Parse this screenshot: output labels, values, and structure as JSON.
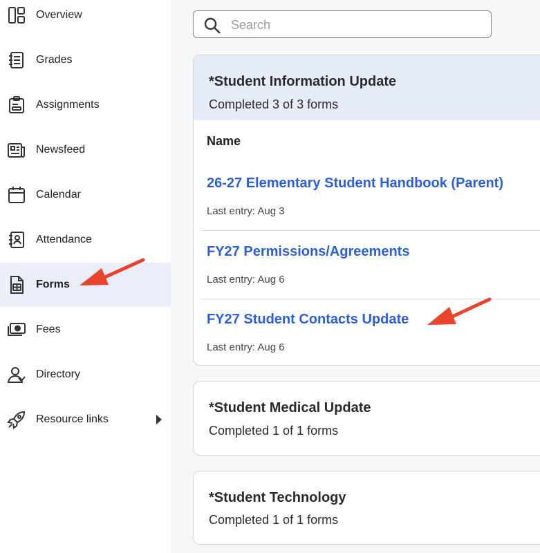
{
  "sidebar": {
    "items": [
      {
        "label": "Overview",
        "icon": "overview-icon"
      },
      {
        "label": "Grades",
        "icon": "gradebook-icon"
      },
      {
        "label": "Assignments",
        "icon": "clipboard-icon"
      },
      {
        "label": "Newsfeed",
        "icon": "newspaper-icon"
      },
      {
        "label": "Calendar",
        "icon": "calendar-icon"
      },
      {
        "label": "Attendance",
        "icon": "contact-book-icon"
      },
      {
        "label": "Forms",
        "icon": "form-document-icon",
        "active": true
      },
      {
        "label": "Fees",
        "icon": "cash-icon"
      },
      {
        "label": "Directory",
        "icon": "people-icon"
      },
      {
        "label": "Resource links",
        "icon": "rocket-icon"
      }
    ]
  },
  "search": {
    "placeholder": "Search"
  },
  "cards": [
    {
      "title": "*Student Information Update",
      "subtitle": "Completed 3 of 3 forms",
      "column_header": "Name",
      "forms": [
        {
          "name": "26-27 Elementary Student Handbook (Parent)",
          "meta": "Last entry: Aug 3"
        },
        {
          "name": "FY27 Permissions/Agreements",
          "meta": "Last entry: Aug 6"
        },
        {
          "name": "FY27 Student Contacts Update",
          "meta": "Last entry: Aug 6"
        }
      ]
    },
    {
      "title": "*Student Medical Update",
      "subtitle": "Completed 1 of 1 forms"
    },
    {
      "title": "*Student Technology",
      "subtitle": "Completed 1 of 1 forms"
    }
  ],
  "colors": {
    "accent": "#2a5fdc",
    "active_bg": "#e9eef8",
    "header_bg": "#e6ecf8",
    "annotation_arrow": "#e8432b"
  }
}
